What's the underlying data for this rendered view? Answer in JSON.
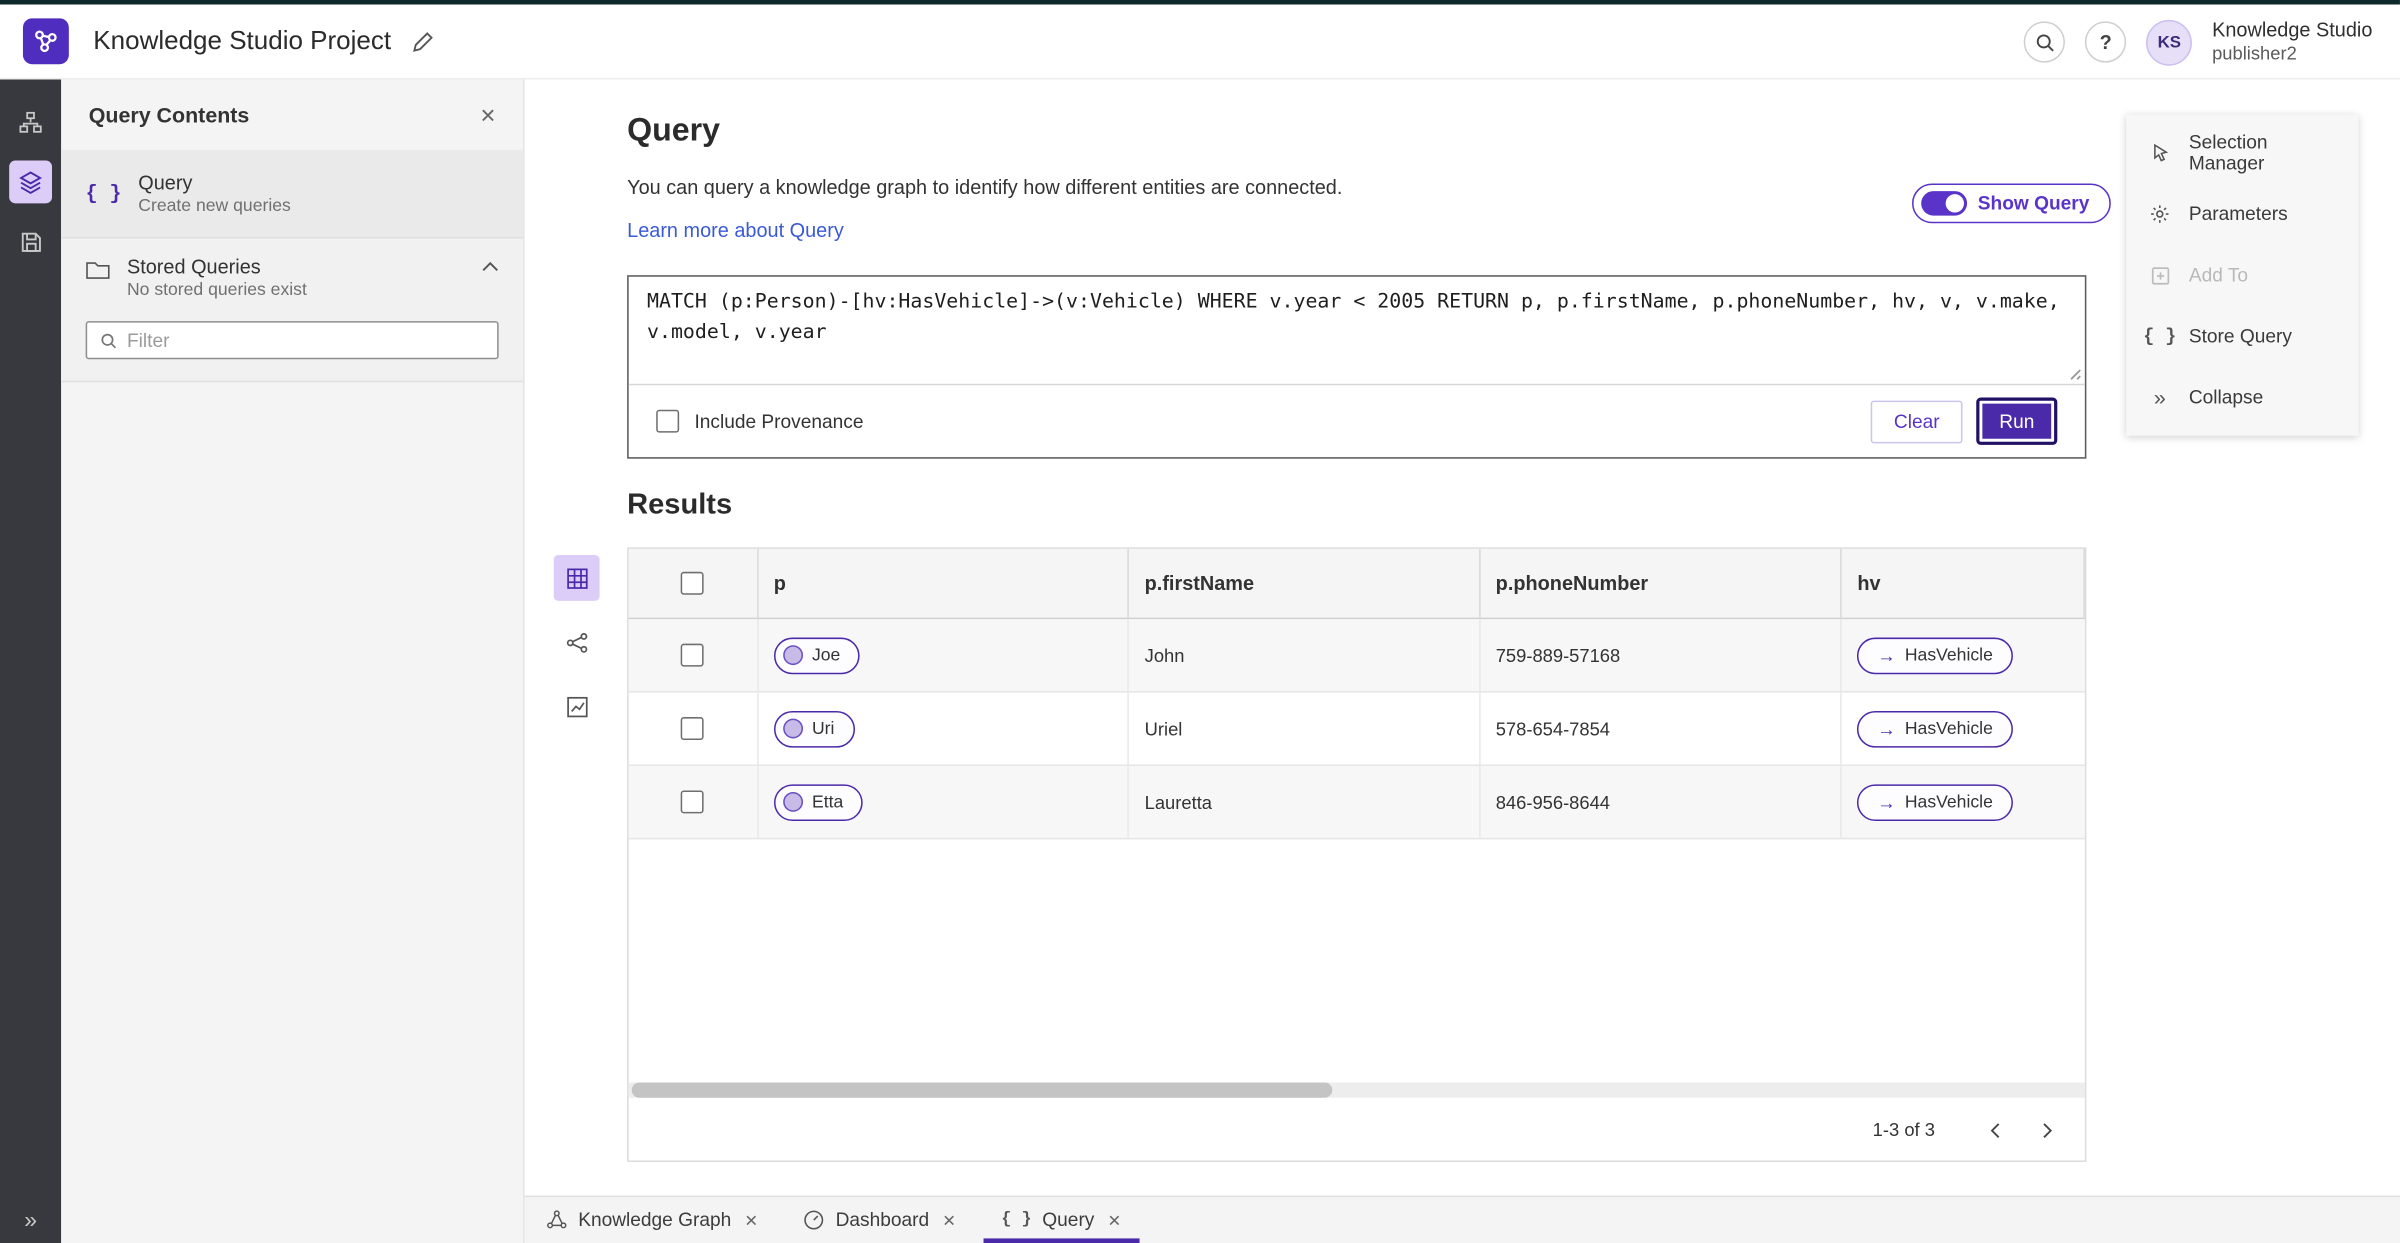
{
  "colors": {
    "accent": "#4b2aa9",
    "accent_light": "#dccdf8",
    "toggle_purple": "#5a34c8",
    "link_blue": "#3b5bd6",
    "rail_background": "#38383f",
    "panel_background": "#f4f4f4"
  },
  "icons": {
    "braces": "{ }",
    "double_chevron_right": "»",
    "close": "×",
    "arrow_right": "→",
    "question": "?"
  },
  "header": {
    "title": "Knowledge Studio Project",
    "user_initials": "KS",
    "user_name": "Knowledge Studio",
    "user_role": "publisher2"
  },
  "left_panel": {
    "title": "Query Contents",
    "query_item": {
      "title": "Query",
      "subtitle": "Create new queries"
    },
    "stored_queries": {
      "title": "Stored Queries",
      "subtitle": "No stored queries exist"
    },
    "filter_placeholder": "Filter"
  },
  "main": {
    "title": "Query",
    "description": "You can query a knowledge graph to identify how different entities are connected.",
    "learn_more": "Learn more about Query",
    "show_query_label": "Show Query",
    "show_query_enabled": true,
    "query_text": "MATCH (p:Person)-[hv:HasVehicle]->(v:Vehicle) WHERE v.year < 2005 RETURN p, p.firstName, p.phoneNumber, hv, v, v.make, v.model, v.year",
    "include_provenance_label": "Include Provenance",
    "include_provenance_checked": false,
    "clear_label": "Clear",
    "run_label": "Run",
    "results_title": "Results"
  },
  "results_table": {
    "columns": [
      "p",
      "p.firstName",
      "p.phoneNumber",
      "hv"
    ],
    "rows": [
      {
        "p": "Joe",
        "firstName": "John",
        "phoneNumber": "759-889-57168",
        "hv": "HasVehicle"
      },
      {
        "p": "Uri",
        "firstName": "Uriel",
        "phoneNumber": "578-654-7854",
        "hv": "HasVehicle"
      },
      {
        "p": "Etta",
        "firstName": "Lauretta",
        "phoneNumber": "846-956-8644",
        "hv": "HasVehicle"
      }
    ],
    "pagination": "1-3 of 3"
  },
  "right_menu": {
    "items": [
      {
        "label": "Selection Manager",
        "disabled": false
      },
      {
        "label": "Parameters",
        "disabled": false
      },
      {
        "label": "Add To",
        "disabled": true
      },
      {
        "label": "Store Query",
        "disabled": false
      },
      {
        "label": "Collapse",
        "disabled": false
      }
    ]
  },
  "bottom_tabs": [
    {
      "label": "Knowledge Graph",
      "active": false
    },
    {
      "label": "Dashboard",
      "active": false
    },
    {
      "label": "Query",
      "active": true
    }
  ]
}
